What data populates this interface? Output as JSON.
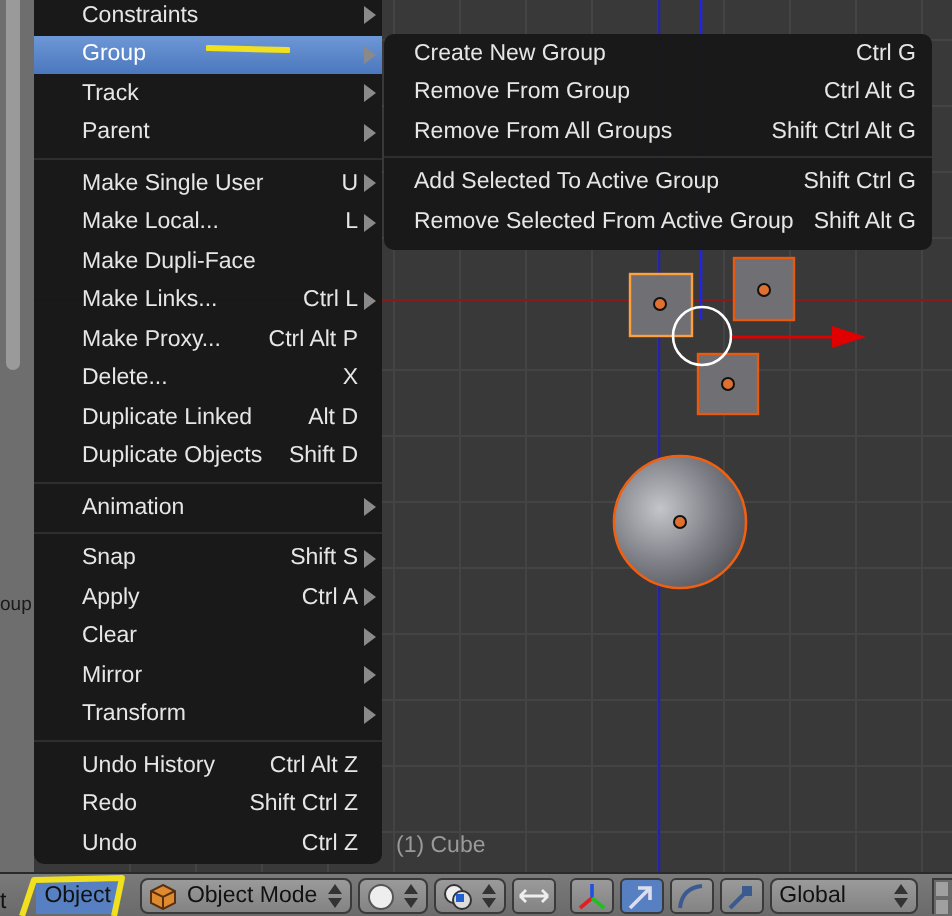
{
  "toolshelf": {
    "cut_label": "oup"
  },
  "viewport": {
    "object_label": "(1) Cube"
  },
  "object_menu": {
    "items": [
      {
        "kind": "item",
        "label": "Constraints",
        "submenu": true,
        "selected": false
      },
      {
        "kind": "item",
        "label": "Group",
        "submenu": true,
        "selected": true
      },
      {
        "kind": "item",
        "label": "Track",
        "submenu": true,
        "selected": false
      },
      {
        "kind": "item",
        "label": "Parent",
        "submenu": true,
        "selected": false
      },
      {
        "kind": "separator"
      },
      {
        "kind": "item",
        "label": "Make Single User",
        "shortcut": "U",
        "submenu": true,
        "selected": false
      },
      {
        "kind": "item",
        "label": "Make Local...",
        "shortcut": "L",
        "submenu": true,
        "selected": false
      },
      {
        "kind": "item",
        "label": "Make Dupli-Face",
        "submenu": false,
        "selected": false
      },
      {
        "kind": "item",
        "label": "Make Links...",
        "shortcut": "Ctrl L",
        "submenu": true,
        "selected": false
      },
      {
        "kind": "item",
        "label": "Make Proxy...",
        "shortcut": "Ctrl Alt P",
        "submenu": false,
        "selected": false
      },
      {
        "kind": "item",
        "label": "Delete...",
        "shortcut": "X",
        "submenu": false,
        "selected": false
      },
      {
        "kind": "item",
        "label": "Duplicate Linked",
        "shortcut": "Alt D",
        "submenu": false,
        "selected": false
      },
      {
        "kind": "item",
        "label": "Duplicate Objects",
        "shortcut": "Shift D",
        "submenu": false,
        "selected": false
      },
      {
        "kind": "separator"
      },
      {
        "kind": "item",
        "label": "Animation",
        "submenu": true,
        "selected": false
      },
      {
        "kind": "separator"
      },
      {
        "kind": "item",
        "label": "Snap",
        "shortcut": "Shift S",
        "submenu": true,
        "selected": false
      },
      {
        "kind": "item",
        "label": "Apply",
        "shortcut": "Ctrl A",
        "submenu": true,
        "selected": false
      },
      {
        "kind": "item",
        "label": "Clear",
        "submenu": true,
        "selected": false
      },
      {
        "kind": "item",
        "label": "Mirror",
        "submenu": true,
        "selected": false
      },
      {
        "kind": "item",
        "label": "Transform",
        "submenu": true,
        "selected": false
      },
      {
        "kind": "separator"
      },
      {
        "kind": "item",
        "label": "Undo History",
        "shortcut": "Ctrl Alt Z",
        "submenu": false,
        "selected": false
      },
      {
        "kind": "item",
        "label": "Redo",
        "shortcut": "Shift Ctrl Z",
        "submenu": false,
        "selected": false
      },
      {
        "kind": "item",
        "label": "Undo",
        "shortcut": "Ctrl Z",
        "submenu": false,
        "selected": false
      }
    ]
  },
  "group_submenu": {
    "items": [
      {
        "kind": "item",
        "label": "Create New Group",
        "shortcut": "Ctrl G"
      },
      {
        "kind": "item",
        "label": "Remove From Group",
        "shortcut": "Ctrl Alt G"
      },
      {
        "kind": "item",
        "label": "Remove From All Groups",
        "shortcut": "Shift Ctrl Alt G"
      },
      {
        "kind": "separator"
      },
      {
        "kind": "item",
        "label": "Add Selected To Active Group",
        "shortcut": "Shift Ctrl G"
      },
      {
        "kind": "item",
        "label": "Remove Selected From Active Group",
        "shortcut": "Shift Alt G"
      }
    ]
  },
  "header": {
    "cut_label": "t",
    "object_menu_button": {
      "label": "Object",
      "selected": true
    },
    "mode_dropdown": "Object Mode",
    "orientation_dropdown": "Global"
  }
}
